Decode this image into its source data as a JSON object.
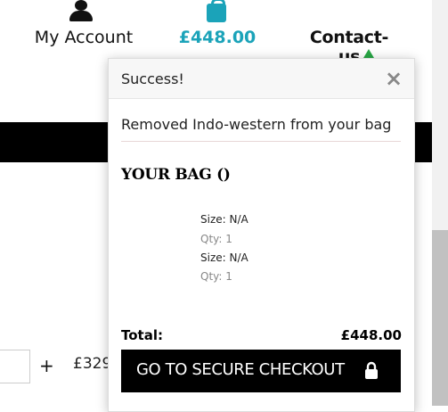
{
  "nav": {
    "account_label": "My Account",
    "bag_total": "£448.00",
    "contact_label": "Contact-us"
  },
  "background": {
    "qty_plus": "+",
    "price_partial": "£329"
  },
  "popup": {
    "title": "Success!",
    "close": "×",
    "message": "Removed Indo-western from your bag",
    "bag_heading": "YOUR BAG ()",
    "items": [
      {
        "size": "Size: N/A",
        "qty": "Qty: 1"
      },
      {
        "size": "Size: N/A",
        "qty": "Qty: 1"
      }
    ],
    "total_label": "Total:",
    "total_value": "£448.00",
    "checkout_label": "GO TO SECURE CHECKOUT"
  },
  "colors": {
    "accent": "#1ba3b9",
    "success_pointer": "#28a745",
    "button": "#000000"
  }
}
